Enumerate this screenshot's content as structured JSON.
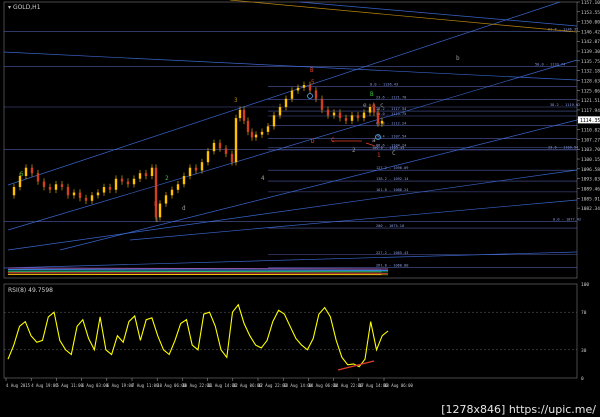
{
  "window": {
    "title": "GOLD,H1",
    "symbol_icon": "triangle-icon"
  },
  "rsi": {
    "title": "RSI(8) 49.7598",
    "levels": [
      "100",
      "70",
      "30",
      "0"
    ]
  },
  "watermark": "[1278x846] https://upic.me/",
  "price_labels": [
    {
      "text": "1157.10",
      "value": 1157.1
    },
    {
      "text": "1153.55",
      "value": 1153.55
    },
    {
      "text": "1150.00",
      "value": 1150.0
    },
    {
      "text": "1146.42",
      "value": 1146.42
    },
    {
      "text": "1142.87",
      "value": 1142.87
    },
    {
      "text": "1139.30",
      "value": 1139.3
    },
    {
      "text": "1135.75",
      "value": 1135.75
    },
    {
      "text": "1132.18",
      "value": 1132.18
    },
    {
      "text": "1128.63",
      "value": 1128.63
    },
    {
      "text": "1125.06",
      "value": 1125.06
    },
    {
      "text": "1121.51",
      "value": 1121.51
    },
    {
      "text": "1117.94",
      "value": 1117.94
    },
    {
      "text": "1114.39",
      "value": 1114.39
    },
    {
      "text": "1110.82",
      "value": 1110.82
    },
    {
      "text": "1107.27",
      "value": 1107.27
    },
    {
      "text": "1103.70",
      "value": 1103.7
    },
    {
      "text": "1100.15",
      "value": 1100.15
    },
    {
      "text": "1096.58",
      "value": 1096.58
    },
    {
      "text": "1093.03",
      "value": 1093.03
    },
    {
      "text": "1089.46",
      "value": 1089.46
    },
    {
      "text": "1085.91",
      "value": 1085.91
    },
    {
      "text": "1082.34",
      "value": 1082.34
    }
  ],
  "current_price": "1114.35",
  "time_labels": [
    "4 Aug 2015",
    "4 Aug 19:00",
    "5 Aug 11:00",
    "6 Aug 03:00",
    "6 Aug 19:00",
    "7 Aug 11:00",
    "10 Aug 06:00",
    "10 Aug 22:00",
    "11 Aug 14:00",
    "12 Aug 06:00",
    "12 Aug 22:00",
    "13 Aug 14:00",
    "14 Aug 06:00",
    "14 Aug 22:00",
    "17 Aug 14:00",
    "18 Aug 06:00"
  ],
  "fib_labels": [
    {
      "text": "61.8 - 1146.32",
      "value": 1146.32
    },
    {
      "text": "50.0 - 1133.74",
      "value": 1133.74
    },
    {
      "text": "0.0 - 1126.43",
      "value": 1126.43
    },
    {
      "text": "23.6 - 1121.70",
      "value": 1121.7
    },
    {
      "text": "38.2 - 1119.02",
      "value": 1119.02
    },
    {
      "text": "38.2 - 1117.54",
      "value": 1117.54
    },
    {
      "text": "50.0 - 1115.75",
      "value": 1115.75
    },
    {
      "text": "61.8 - 1112.24",
      "value": 1112.24
    },
    {
      "text": "76.4 - 1107.54",
      "value": 1107.54
    },
    {
      "text": "88.6 - 1104.24",
      "value": 1104.24
    },
    {
      "text": "100.0 - 1103.43",
      "value": 1103.43
    },
    {
      "text": "23.6 - 1103.54",
      "value": 1103.54
    },
    {
      "text": "127.2 - 1096.09",
      "value": 1096.09
    },
    {
      "text": "138.2 - 1092.14",
      "value": 1092.14
    },
    {
      "text": "161.8 - 1088.24",
      "value": 1088.24
    },
    {
      "text": "0.0 - 1077.42",
      "value": 1077.42
    },
    {
      "text": "200 - 1075.10",
      "value": 1075.1
    },
    {
      "text": "227.2 - 1065.43",
      "value": 1065.43
    },
    {
      "text": "261.8 - 1060.80",
      "value": 1060.8
    }
  ],
  "wave_labels": [
    {
      "text": "5",
      "color": "#3cc43c"
    },
    {
      "text": "1",
      "color": "#9a9a9a"
    },
    {
      "text": "2",
      "color": "#3cc43c"
    },
    {
      "text": "3",
      "color": "#b8860b"
    },
    {
      "text": "4",
      "color": "#9a9a9a"
    },
    {
      "text": "5",
      "color": "#e0402a"
    },
    {
      "text": "B",
      "color": "#e0402a"
    },
    {
      "text": "B",
      "color": "#3cc43c"
    },
    {
      "text": "A",
      "color": "#e0402a"
    },
    {
      "text": "C",
      "color": "#e0402a"
    },
    {
      "text": "D",
      "color": "#e0402a"
    },
    {
      "text": "E",
      "color": "#e0402a"
    },
    {
      "text": "1",
      "color": "#e0402a"
    },
    {
      "text": "C",
      "color": "#9a9a9a"
    },
    {
      "text": "2",
      "color": "#9a9a9a"
    },
    {
      "text": "a",
      "color": "#9a9a9a"
    },
    {
      "text": "b",
      "color": "#9a9a9a"
    },
    {
      "text": "c",
      "color": "#9a9a9a"
    },
    {
      "text": "d",
      "color": "#9a9a9a"
    },
    {
      "text": "e",
      "color": "#9a9a9a"
    }
  ],
  "colors": {
    "background": "#000000",
    "candle": "#ffc000",
    "rsi": "#ffff00",
    "channel": "#3f6fe0",
    "fib": "#5c6bc0",
    "grid_text": "#cfcfcf",
    "accent_red": "#e0402a"
  }
}
